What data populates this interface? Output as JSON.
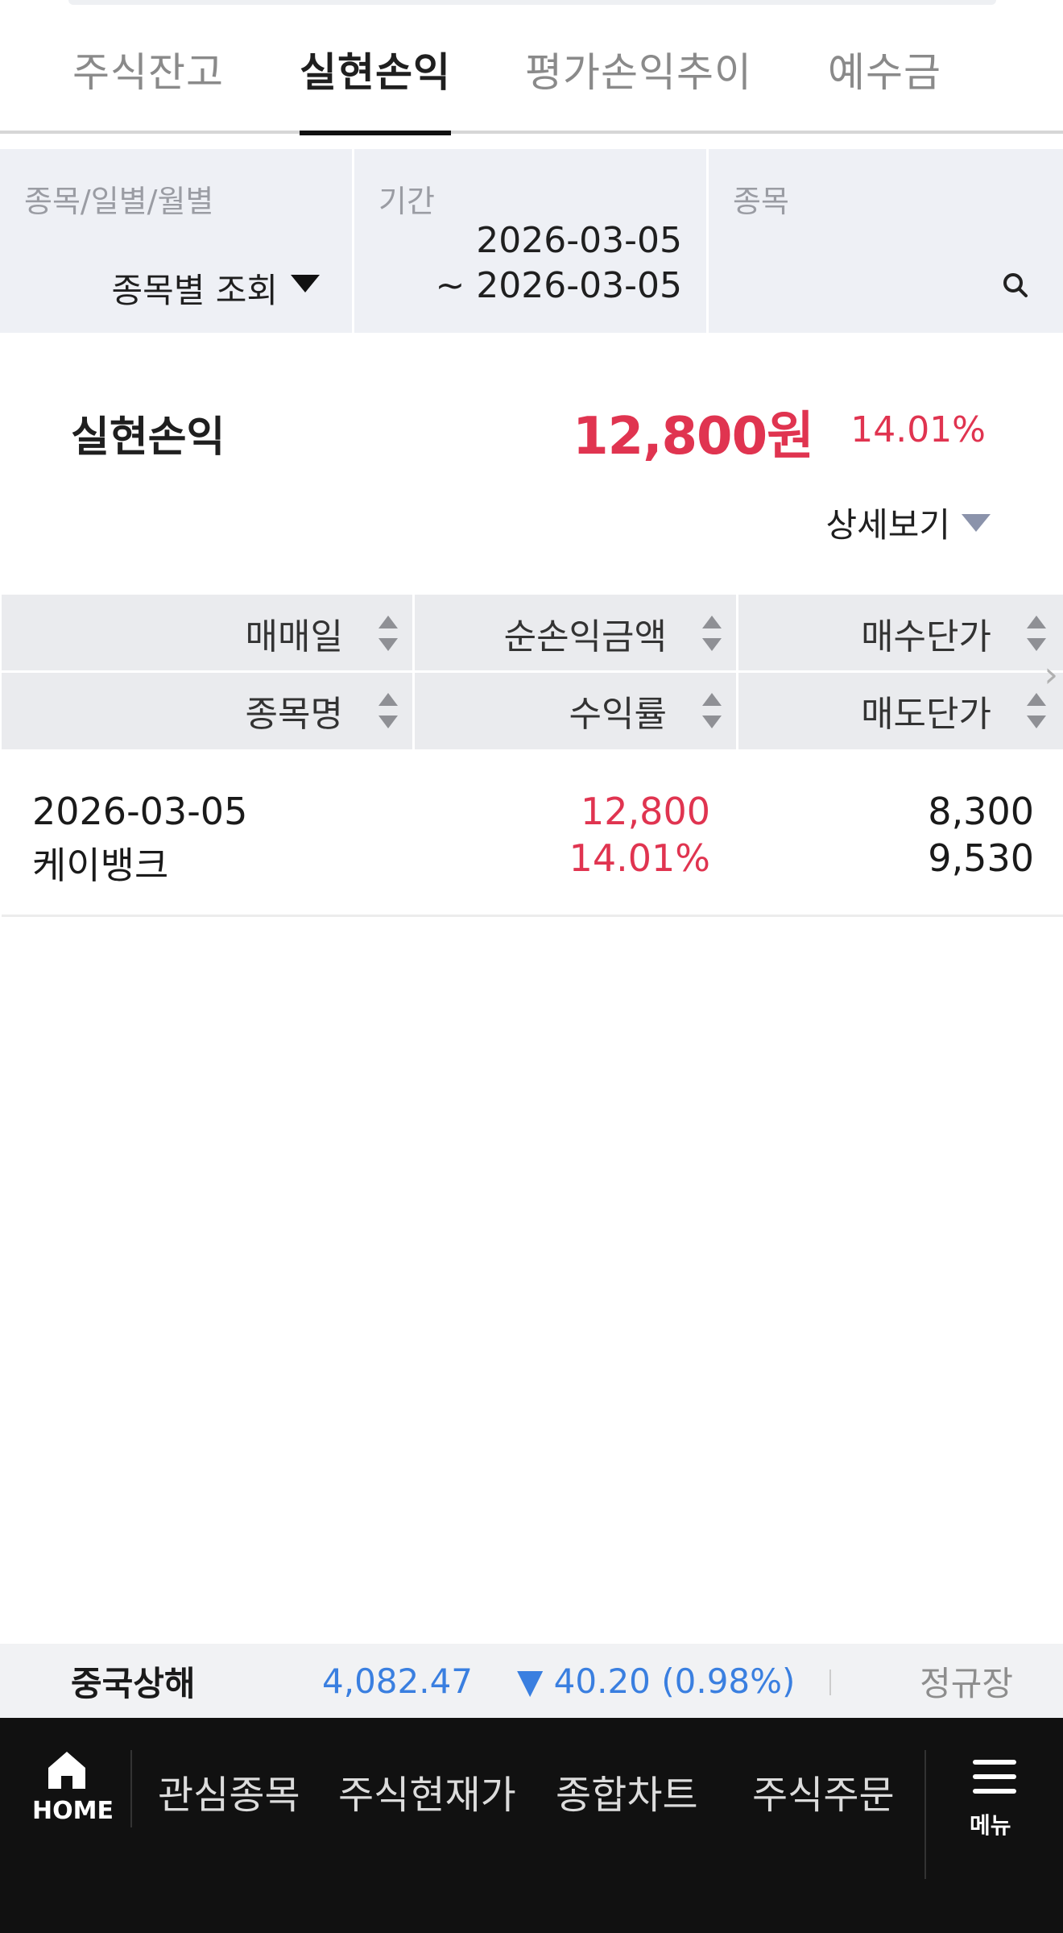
{
  "tabs": [
    {
      "label": "주식잔고",
      "active": false
    },
    {
      "label": "실현손익",
      "active": true
    },
    {
      "label": "평가손익추이",
      "active": false
    },
    {
      "label": "예수금",
      "active": false
    }
  ],
  "filters": {
    "type": {
      "label": "종목/일별/월별",
      "value": "종목별 조회"
    },
    "period": {
      "label": "기간",
      "start": "2026-03-05",
      "end": "~ 2026-03-05"
    },
    "stock": {
      "label": "종목"
    }
  },
  "summary": {
    "label": "실현손익",
    "amount": "12,800원",
    "rate": "14.01%",
    "detail_label": "상세보기"
  },
  "table": {
    "headers_top": [
      "매매일",
      "순손익금액",
      "매수단가"
    ],
    "headers_bottom": [
      "종목명",
      "수익률",
      "매도단가"
    ],
    "rows": [
      {
        "date": "2026-03-05",
        "name": "케이뱅크",
        "amount": "12,800",
        "rate": "14.01%",
        "buy_price": "8,300",
        "sell_price": "9,530"
      }
    ]
  },
  "ticker": {
    "name": "중국상해",
    "price": "4,082.47",
    "change": "▼ 40.20 (0.98%)",
    "session": "정규장"
  },
  "nav": {
    "home": "HOME",
    "items": [
      "관심종목",
      "주식현재가",
      "종합차트",
      "주식주문"
    ],
    "menu": "메뉴"
  },
  "colors": {
    "profit": "#e03450",
    "loss": "#3a7fe0",
    "nav_bg": "#111111"
  }
}
